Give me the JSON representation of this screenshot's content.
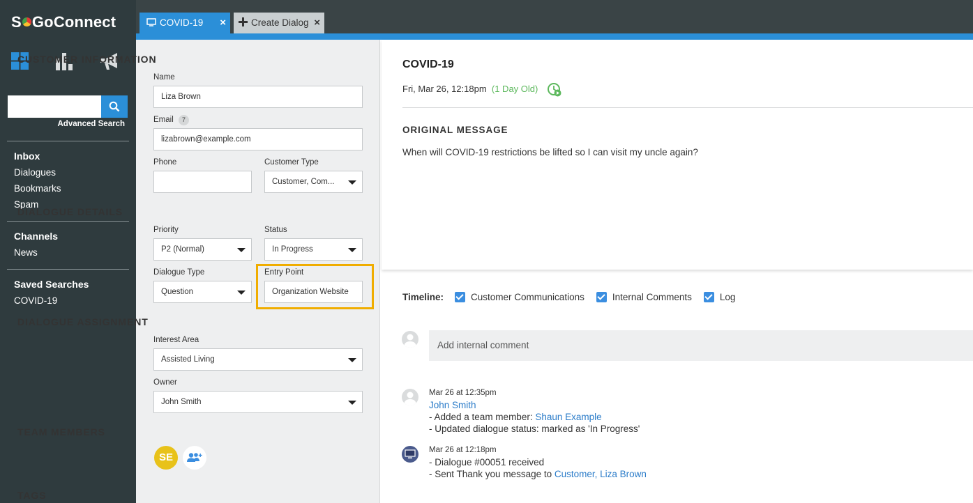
{
  "app": {
    "brand": "SoGoConnect",
    "brand_prefix": "S",
    "brand_suffix": "GoConnect"
  },
  "sidebar": {
    "nav_icons": [
      "dashboard-icon",
      "reports-icon",
      "megaphone-icon"
    ],
    "search": {
      "placeholder": "",
      "value": "",
      "advanced_label": "Advanced Search"
    },
    "inbox": {
      "heading": "Inbox",
      "items": [
        "Dialogues",
        "Bookmarks",
        "Spam"
      ]
    },
    "channels": {
      "heading": "Channels",
      "items": [
        "News"
      ]
    },
    "saved_searches": {
      "heading": "Saved Searches",
      "items": [
        "COVID-19"
      ]
    }
  },
  "tabs": [
    {
      "label": "COVID-19",
      "icon": "monitor-icon",
      "active": true
    },
    {
      "label": "Create Dialog",
      "icon": "plus-icon",
      "active": false
    }
  ],
  "customer": {
    "heading": "CUSTOMER INFORMATION",
    "name_label": "Name",
    "name_value": "Liza Brown",
    "email_label": "Email",
    "email_count": "7",
    "email_value": "lizabrown@example.com",
    "phone_label": "Phone",
    "phone_value": "",
    "type_label": "Customer Type",
    "type_value": "Customer, Com..."
  },
  "details": {
    "heading": "DIALOGUE DETAILS",
    "priority_label": "Priority",
    "priority_value": "P2 (Normal)",
    "status_label": "Status",
    "status_value": "In Progress",
    "type_label": "Dialogue Type",
    "type_value": "Question",
    "entry_label": "Entry Point",
    "entry_value": "Organization Website"
  },
  "assignment": {
    "heading": "DIALOGUE ASSIGNMENT",
    "interest_label": "Interest Area",
    "interest_value": "Assisted Living",
    "owner_label": "Owner",
    "owner_value": "John Smith"
  },
  "team": {
    "heading": "TEAM MEMBERS",
    "member_initials": "SE"
  },
  "tags": {
    "heading": "TAGS"
  },
  "dialogue": {
    "title": "COVID-19",
    "date": "Fri, Mar 26, 12:18pm",
    "age": "(1 Day Old)",
    "original_heading": "ORIGINAL MESSAGE",
    "original_body": "When will COVID-19 restrictions be lifted so I can visit my uncle again?"
  },
  "timeline": {
    "label": "Timeline:",
    "filters": [
      "Customer Communications",
      "Internal Comments",
      "Log"
    ],
    "comment_placeholder": "Add internal comment",
    "entries": [
      {
        "time": "Mar 26 at 12:35pm",
        "author": "John Smith",
        "line1_prefix": "-  Added a team member: ",
        "line1_link": "Shaun Example",
        "line2": "-  Updated dialogue status: marked as 'In Progress'"
      },
      {
        "time": "Mar 26 at 12:18pm",
        "line1": "-  Dialogue #00051 received",
        "line2_prefix": "-  Sent Thank you message to ",
        "line2_link": "Customer, Liza Brown"
      }
    ]
  },
  "colors": {
    "accent": "#2b8fd8",
    "sidebar": "#2f3b3e",
    "highlight": "#f0ad00",
    "age": "#5cb85c",
    "link": "#2b7cc9"
  }
}
